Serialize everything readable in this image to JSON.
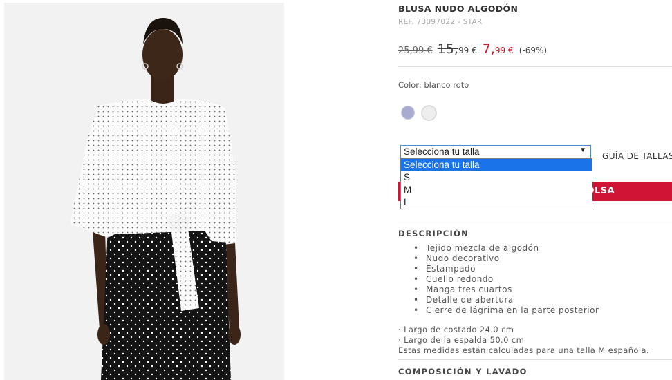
{
  "product": {
    "name": "BLUSA NUDO ALGODÓN",
    "reference": "REF. 73097022 - STAR",
    "price_original": "25,99 €",
    "price_previous_int": "15,",
    "price_previous_dec": "99 €",
    "price_current_int": "7,",
    "price_current_dec": "99 €",
    "discount": "(-69%)",
    "color_label": "Color: blanco roto",
    "swatches": [
      {
        "name": "lavender",
        "color": "#a9abd0"
      },
      {
        "name": "off-white",
        "color": "#eeeeee"
      }
    ]
  },
  "size_select": {
    "selected": "Selecciona tu talla",
    "options": [
      "Selecciona tu talla",
      "S",
      "M",
      "L"
    ]
  },
  "size_guide_label": "GUÍA DE TALLAS",
  "add_to_bag_label": "BOLSA",
  "description": {
    "title": "DESCRIPCIÓN",
    "features": [
      "Tejido mezcla de algodón",
      "Nudo decorativo",
      "Estampado",
      "Cuello redondo",
      "Manga tres cuartos",
      "Detalle de abertura",
      "Cierre de lágrima en la parte posterior"
    ],
    "measurements": [
      "· Largo de costado 24.0 cm",
      "· Largo de la espalda 50.0 cm",
      "Estas medidas están calculadas para una talla M española."
    ]
  },
  "composition_title": "COMPOSICIÓN Y LAVADO",
  "colors": {
    "accent_red": "#cf1436",
    "select_highlight": "#1a73e8"
  }
}
